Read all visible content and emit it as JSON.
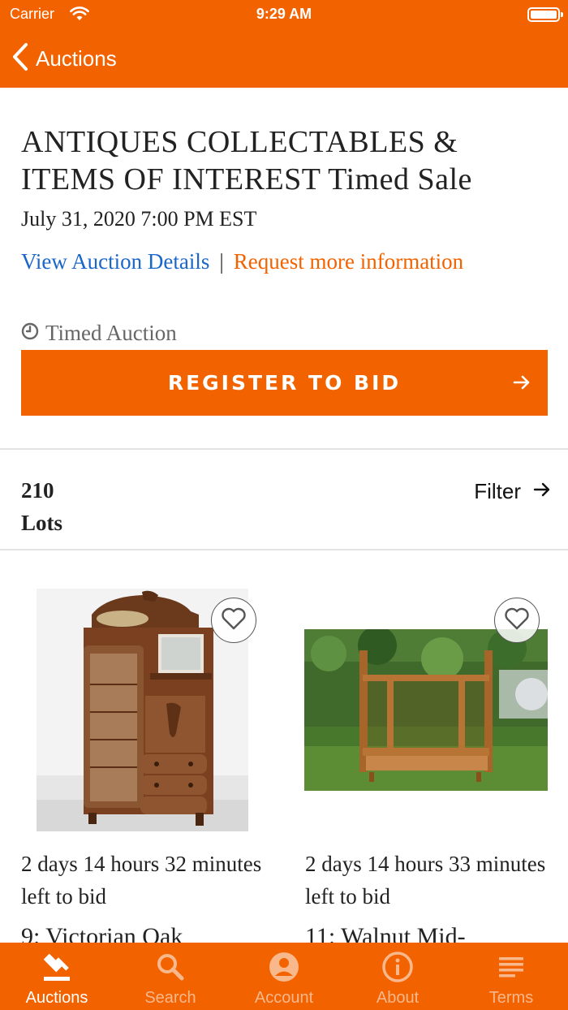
{
  "status_bar": {
    "carrier": "Carrier",
    "time": "9:29 AM"
  },
  "nav": {
    "back_label": "Auctions"
  },
  "auction": {
    "title": "ANTIQUES COLLECTABLES & ITEMS OF INTEREST Timed Sale",
    "date": "July 31, 2020 7:00 PM EST",
    "details_link": "View Auction Details",
    "separator": "|",
    "request_link": "Request more information",
    "type": "Timed Auction",
    "register_label": "REGISTER TO BID"
  },
  "lots": {
    "count": "210",
    "count_label": "Lots",
    "filter_label": "Filter",
    "items": [
      {
        "time_left": "2 days 14 hours 32 minutes left to bid",
        "title": "9: Victorian Oak"
      },
      {
        "time_left": "2 days 14 hours 33 minutes left to bid",
        "title": "11: Walnut Mid-"
      }
    ]
  },
  "tab_bar": {
    "tabs": [
      {
        "label": "Auctions",
        "icon": "gavel-icon",
        "active": true
      },
      {
        "label": "Search",
        "icon": "search-icon",
        "active": false
      },
      {
        "label": "Account",
        "icon": "account-icon",
        "active": false
      },
      {
        "label": "About",
        "icon": "info-icon",
        "active": false
      },
      {
        "label": "Terms",
        "icon": "terms-icon",
        "active": false
      }
    ]
  },
  "colors": {
    "brand": "#f26300",
    "link_blue": "#1a66c9",
    "tab_inactive": "#f8b88c"
  }
}
